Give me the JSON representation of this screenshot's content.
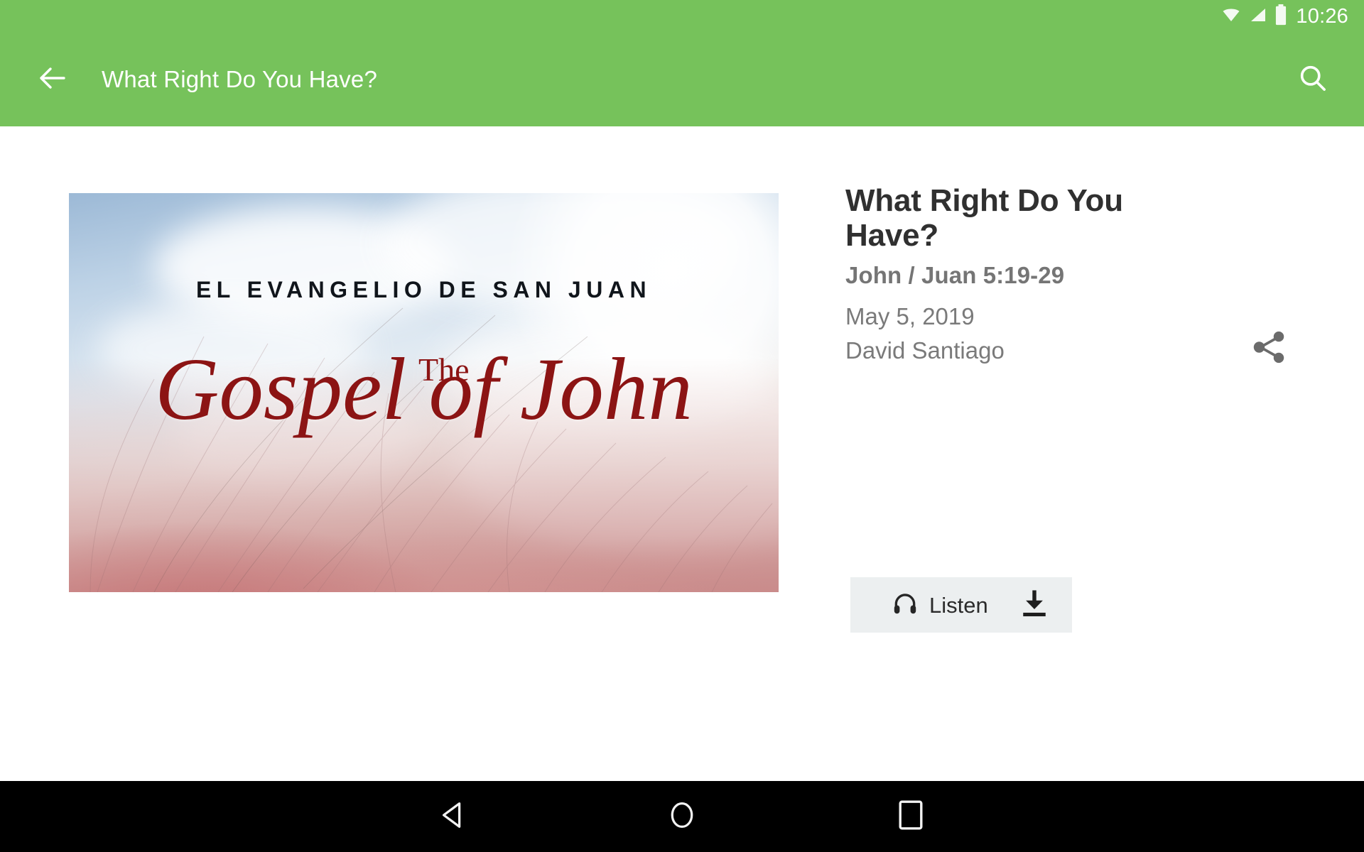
{
  "status_bar": {
    "time": "10:26",
    "icons": [
      "wifi-icon",
      "cellular-signal-icon",
      "battery-icon"
    ]
  },
  "app_bar": {
    "back_icon": "back-arrow-icon",
    "title": "What Right Do You Have?",
    "search_icon": "search-icon",
    "background_color": "#76c25b"
  },
  "artwork": {
    "subtitle": "EL EVANGELIO DE SAN JUAN",
    "the": "The",
    "title": "Gospel of John",
    "title_color": "#8c1414"
  },
  "details": {
    "title": "What Right Do You Have?",
    "scripture": "John / Juan 5:19-29",
    "date": "May 5, 2019",
    "speaker": "David Santiago",
    "share_icon": "share-icon"
  },
  "listen": {
    "headphones_icon": "headphones-icon",
    "label": "Listen",
    "download_icon": "download-icon",
    "background_color": "#eceff0"
  },
  "nav_bar": {
    "back": "nav-back-triangle-icon",
    "home": "nav-home-circle-icon",
    "recents": "nav-recents-square-icon"
  }
}
